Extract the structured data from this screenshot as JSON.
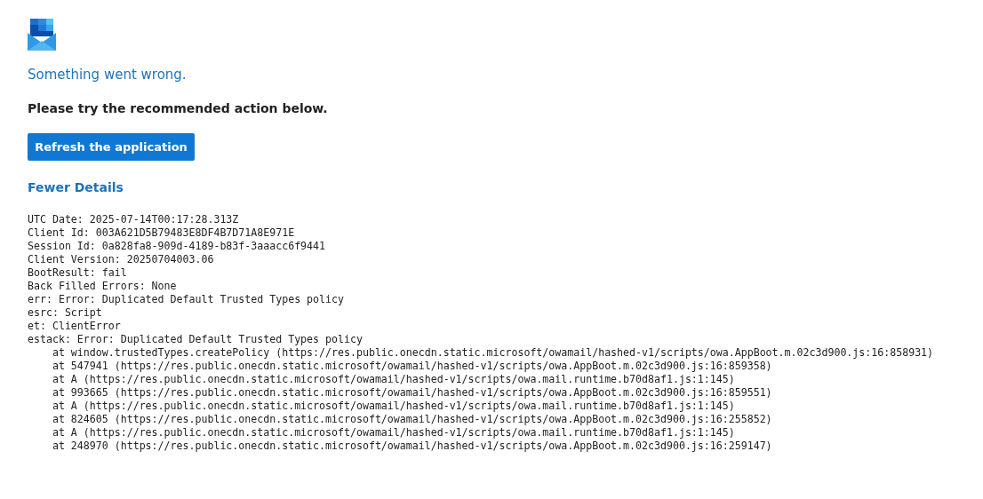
{
  "heading": "Something went wrong.",
  "message": "Please try the recommended action below.",
  "action_button": "Refresh the application",
  "details_toggle": "Fewer Details",
  "details": [
    "UTC Date: 2025-07-14T00:17:28.313Z",
    "Client Id: 003A621D5B79483E8DF4B7D71A8E971E",
    "Session Id: 0a828fa8-909d-4189-b83f-3aaacc6f9441",
    "Client Version: 20250704003.06",
    "BootResult: fail",
    "Back Filled Errors: None",
    "err: Error: Duplicated Default Trusted Types policy",
    "esrc: Script",
    "et: ClientError",
    "estack: Error: Duplicated Default Trusted Types policy",
    "    at window.trustedTypes.createPolicy (https://res.public.onecdn.static.microsoft/owamail/hashed-v1/scripts/owa.AppBoot.m.02c3d900.js:16:858931)",
    "    at 547941 (https://res.public.onecdn.static.microsoft/owamail/hashed-v1/scripts/owa.AppBoot.m.02c3d900.js:16:859358)",
    "    at A (https://res.public.onecdn.static.microsoft/owamail/hashed-v1/scripts/owa.mail.runtime.b70d8af1.js:1:145)",
    "    at 993665 (https://res.public.onecdn.static.microsoft/owamail/hashed-v1/scripts/owa.AppBoot.m.02c3d900.js:16:859551)",
    "    at A (https://res.public.onecdn.static.microsoft/owamail/hashed-v1/scripts/owa.mail.runtime.b70d8af1.js:1:145)",
    "    at 824605 (https://res.public.onecdn.static.microsoft/owamail/hashed-v1/scripts/owa.AppBoot.m.02c3d900.js:16:255852)",
    "    at A (https://res.public.onecdn.static.microsoft/owamail/hashed-v1/scripts/owa.mail.runtime.b70d8af1.js:1:145)",
    "    at 248970 (https://res.public.onecdn.static.microsoft/owamail/hashed-v1/scripts/owa.AppBoot.m.02c3d900.js:16:259147)"
  ]
}
